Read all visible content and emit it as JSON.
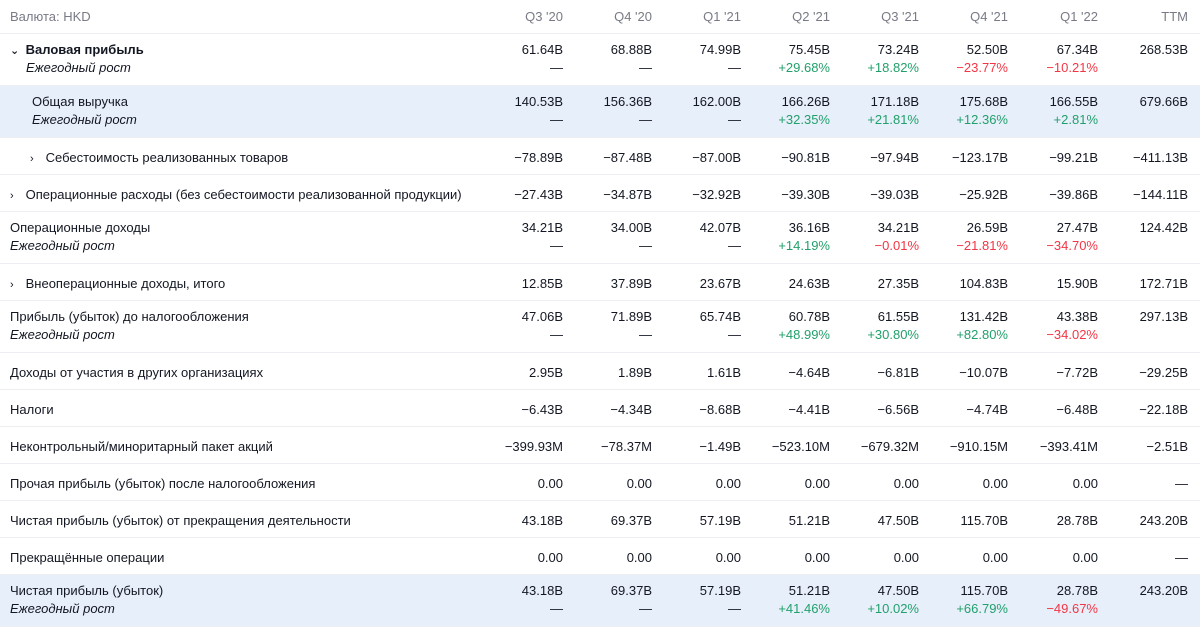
{
  "header": {
    "currency_label": "Валюта: HKD",
    "periods": [
      "Q3 '20",
      "Q4 '20",
      "Q1 '21",
      "Q2 '21",
      "Q3 '21",
      "Q4 '21",
      "Q1 '22",
      "TTM"
    ]
  },
  "growth_label": "Ежегодный рост",
  "rows": [
    {
      "label": "Валовая прибыль",
      "chevron": "down",
      "bold": true,
      "highlight": false,
      "values": [
        "61.64B",
        "68.88B",
        "74.99B",
        "75.45B",
        "73.24B",
        "52.50B",
        "67.34B",
        "268.53B"
      ],
      "growth": [
        "—",
        "—",
        "—",
        "+29.68%",
        "+18.82%",
        "−23.77%",
        "−10.21%",
        ""
      ]
    },
    {
      "label": "Общая выручка",
      "chevron": "",
      "bold": false,
      "highlight": true,
      "indent": true,
      "values": [
        "140.53B",
        "156.36B",
        "162.00B",
        "166.26B",
        "171.18B",
        "175.68B",
        "166.55B",
        "679.66B"
      ],
      "growth": [
        "—",
        "—",
        "—",
        "+32.35%",
        "+21.81%",
        "+12.36%",
        "+2.81%",
        ""
      ]
    },
    {
      "label": "Себестоимость реализованных товаров",
      "chevron": "right",
      "bold": false,
      "highlight": false,
      "indent": true,
      "values": [
        "−78.89B",
        "−87.48B",
        "−87.00B",
        "−90.81B",
        "−97.94B",
        "−123.17B",
        "−99.21B",
        "−411.13B"
      ]
    },
    {
      "label": "Операционные расходы (без себестоимости реализованной продукции)",
      "chevron": "right",
      "bold": false,
      "highlight": false,
      "values": [
        "−27.43B",
        "−34.87B",
        "−32.92B",
        "−39.30B",
        "−39.03B",
        "−25.92B",
        "−39.86B",
        "−144.11B"
      ]
    },
    {
      "label": "Операционные доходы",
      "chevron": "",
      "bold": false,
      "highlight": false,
      "values": [
        "34.21B",
        "34.00B",
        "42.07B",
        "36.16B",
        "34.21B",
        "26.59B",
        "27.47B",
        "124.42B"
      ],
      "growth": [
        "—",
        "—",
        "—",
        "+14.19%",
        "−0.01%",
        "−21.81%",
        "−34.70%",
        ""
      ]
    },
    {
      "label": "Внеоперационные доходы, итого",
      "chevron": "right",
      "bold": false,
      "highlight": false,
      "values": [
        "12.85B",
        "37.89B",
        "23.67B",
        "24.63B",
        "27.35B",
        "104.83B",
        "15.90B",
        "172.71B"
      ]
    },
    {
      "label": "Прибыль (убыток) до налогообложения",
      "chevron": "",
      "bold": false,
      "highlight": false,
      "values": [
        "47.06B",
        "71.89B",
        "65.74B",
        "60.78B",
        "61.55B",
        "131.42B",
        "43.38B",
        "297.13B"
      ],
      "growth": [
        "—",
        "—",
        "—",
        "+48.99%",
        "+30.80%",
        "+82.80%",
        "−34.02%",
        ""
      ]
    },
    {
      "label": "Доходы от участия в других организациях",
      "chevron": "",
      "bold": false,
      "highlight": false,
      "values": [
        "2.95B",
        "1.89B",
        "1.61B",
        "−4.64B",
        "−6.81B",
        "−10.07B",
        "−7.72B",
        "−29.25B"
      ]
    },
    {
      "label": "Налоги",
      "chevron": "",
      "bold": false,
      "highlight": false,
      "values": [
        "−6.43B",
        "−4.34B",
        "−8.68B",
        "−4.41B",
        "−6.56B",
        "−4.74B",
        "−6.48B",
        "−22.18B"
      ]
    },
    {
      "label": "Неконтрольный/миноритарный пакет акций",
      "chevron": "",
      "bold": false,
      "highlight": false,
      "values": [
        "−399.93M",
        "−78.37M",
        "−1.49B",
        "−523.10M",
        "−679.32M",
        "−910.15M",
        "−393.41M",
        "−2.51B"
      ]
    },
    {
      "label": "Прочая прибыль (убыток) после налогообложения",
      "chevron": "",
      "bold": false,
      "highlight": false,
      "values": [
        "0.00",
        "0.00",
        "0.00",
        "0.00",
        "0.00",
        "0.00",
        "0.00",
        "—"
      ]
    },
    {
      "label": "Чистая прибыль (убыток) от прекращения деятельности",
      "chevron": "",
      "bold": false,
      "highlight": false,
      "values": [
        "43.18B",
        "69.37B",
        "57.19B",
        "51.21B",
        "47.50B",
        "115.70B",
        "28.78B",
        "243.20B"
      ]
    },
    {
      "label": "Прекращённые операции",
      "chevron": "",
      "bold": false,
      "highlight": false,
      "values": [
        "0.00",
        "0.00",
        "0.00",
        "0.00",
        "0.00",
        "0.00",
        "0.00",
        "—"
      ]
    },
    {
      "label": "Чистая прибыль (убыток)",
      "chevron": "",
      "bold": false,
      "highlight": true,
      "values": [
        "43.18B",
        "69.37B",
        "57.19B",
        "51.21B",
        "47.50B",
        "115.70B",
        "28.78B",
        "243.20B"
      ],
      "growth": [
        "—",
        "—",
        "—",
        "+41.46%",
        "+10.02%",
        "+66.79%",
        "−49.67%",
        ""
      ]
    }
  ],
  "colors": {
    "positive": "#22a06b",
    "negative": "#f23645",
    "highlight_bg": "#e7effa"
  },
  "icons": {
    "expanded": "chevron-down-icon",
    "collapsed": "chevron-right-icon"
  }
}
